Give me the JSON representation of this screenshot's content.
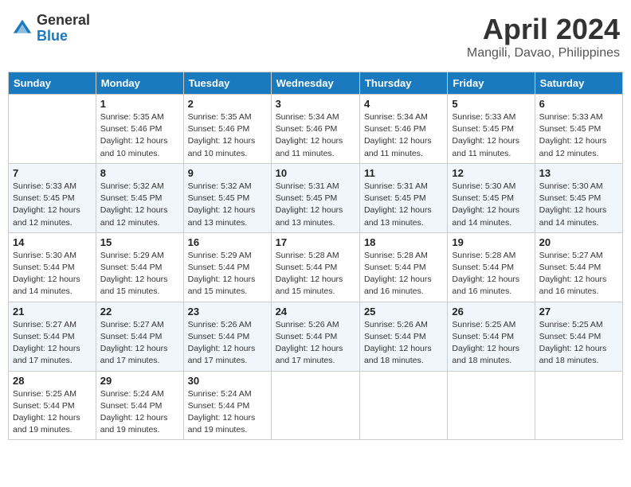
{
  "logo": {
    "general": "General",
    "blue": "Blue"
  },
  "title": "April 2024",
  "subtitle": "Mangili, Davao, Philippines",
  "header_days": [
    "Sunday",
    "Monday",
    "Tuesday",
    "Wednesday",
    "Thursday",
    "Friday",
    "Saturday"
  ],
  "weeks": [
    [
      {
        "day": "",
        "info": ""
      },
      {
        "day": "1",
        "info": "Sunrise: 5:35 AM\nSunset: 5:46 PM\nDaylight: 12 hours\nand 10 minutes."
      },
      {
        "day": "2",
        "info": "Sunrise: 5:35 AM\nSunset: 5:46 PM\nDaylight: 12 hours\nand 10 minutes."
      },
      {
        "day": "3",
        "info": "Sunrise: 5:34 AM\nSunset: 5:46 PM\nDaylight: 12 hours\nand 11 minutes."
      },
      {
        "day": "4",
        "info": "Sunrise: 5:34 AM\nSunset: 5:46 PM\nDaylight: 12 hours\nand 11 minutes."
      },
      {
        "day": "5",
        "info": "Sunrise: 5:33 AM\nSunset: 5:45 PM\nDaylight: 12 hours\nand 11 minutes."
      },
      {
        "day": "6",
        "info": "Sunrise: 5:33 AM\nSunset: 5:45 PM\nDaylight: 12 hours\nand 12 minutes."
      }
    ],
    [
      {
        "day": "7",
        "info": "Sunrise: 5:33 AM\nSunset: 5:45 PM\nDaylight: 12 hours\nand 12 minutes."
      },
      {
        "day": "8",
        "info": "Sunrise: 5:32 AM\nSunset: 5:45 PM\nDaylight: 12 hours\nand 12 minutes."
      },
      {
        "day": "9",
        "info": "Sunrise: 5:32 AM\nSunset: 5:45 PM\nDaylight: 12 hours\nand 13 minutes."
      },
      {
        "day": "10",
        "info": "Sunrise: 5:31 AM\nSunset: 5:45 PM\nDaylight: 12 hours\nand 13 minutes."
      },
      {
        "day": "11",
        "info": "Sunrise: 5:31 AM\nSunset: 5:45 PM\nDaylight: 12 hours\nand 13 minutes."
      },
      {
        "day": "12",
        "info": "Sunrise: 5:30 AM\nSunset: 5:45 PM\nDaylight: 12 hours\nand 14 minutes."
      },
      {
        "day": "13",
        "info": "Sunrise: 5:30 AM\nSunset: 5:45 PM\nDaylight: 12 hours\nand 14 minutes."
      }
    ],
    [
      {
        "day": "14",
        "info": "Sunrise: 5:30 AM\nSunset: 5:44 PM\nDaylight: 12 hours\nand 14 minutes."
      },
      {
        "day": "15",
        "info": "Sunrise: 5:29 AM\nSunset: 5:44 PM\nDaylight: 12 hours\nand 15 minutes."
      },
      {
        "day": "16",
        "info": "Sunrise: 5:29 AM\nSunset: 5:44 PM\nDaylight: 12 hours\nand 15 minutes."
      },
      {
        "day": "17",
        "info": "Sunrise: 5:28 AM\nSunset: 5:44 PM\nDaylight: 12 hours\nand 15 minutes."
      },
      {
        "day": "18",
        "info": "Sunrise: 5:28 AM\nSunset: 5:44 PM\nDaylight: 12 hours\nand 16 minutes."
      },
      {
        "day": "19",
        "info": "Sunrise: 5:28 AM\nSunset: 5:44 PM\nDaylight: 12 hours\nand 16 minutes."
      },
      {
        "day": "20",
        "info": "Sunrise: 5:27 AM\nSunset: 5:44 PM\nDaylight: 12 hours\nand 16 minutes."
      }
    ],
    [
      {
        "day": "21",
        "info": "Sunrise: 5:27 AM\nSunset: 5:44 PM\nDaylight: 12 hours\nand 17 minutes."
      },
      {
        "day": "22",
        "info": "Sunrise: 5:27 AM\nSunset: 5:44 PM\nDaylight: 12 hours\nand 17 minutes."
      },
      {
        "day": "23",
        "info": "Sunrise: 5:26 AM\nSunset: 5:44 PM\nDaylight: 12 hours\nand 17 minutes."
      },
      {
        "day": "24",
        "info": "Sunrise: 5:26 AM\nSunset: 5:44 PM\nDaylight: 12 hours\nand 17 minutes."
      },
      {
        "day": "25",
        "info": "Sunrise: 5:26 AM\nSunset: 5:44 PM\nDaylight: 12 hours\nand 18 minutes."
      },
      {
        "day": "26",
        "info": "Sunrise: 5:25 AM\nSunset: 5:44 PM\nDaylight: 12 hours\nand 18 minutes."
      },
      {
        "day": "27",
        "info": "Sunrise: 5:25 AM\nSunset: 5:44 PM\nDaylight: 12 hours\nand 18 minutes."
      }
    ],
    [
      {
        "day": "28",
        "info": "Sunrise: 5:25 AM\nSunset: 5:44 PM\nDaylight: 12 hours\nand 19 minutes."
      },
      {
        "day": "29",
        "info": "Sunrise: 5:24 AM\nSunset: 5:44 PM\nDaylight: 12 hours\nand 19 minutes."
      },
      {
        "day": "30",
        "info": "Sunrise: 5:24 AM\nSunset: 5:44 PM\nDaylight: 12 hours\nand 19 minutes."
      },
      {
        "day": "",
        "info": ""
      },
      {
        "day": "",
        "info": ""
      },
      {
        "day": "",
        "info": ""
      },
      {
        "day": "",
        "info": ""
      }
    ]
  ]
}
